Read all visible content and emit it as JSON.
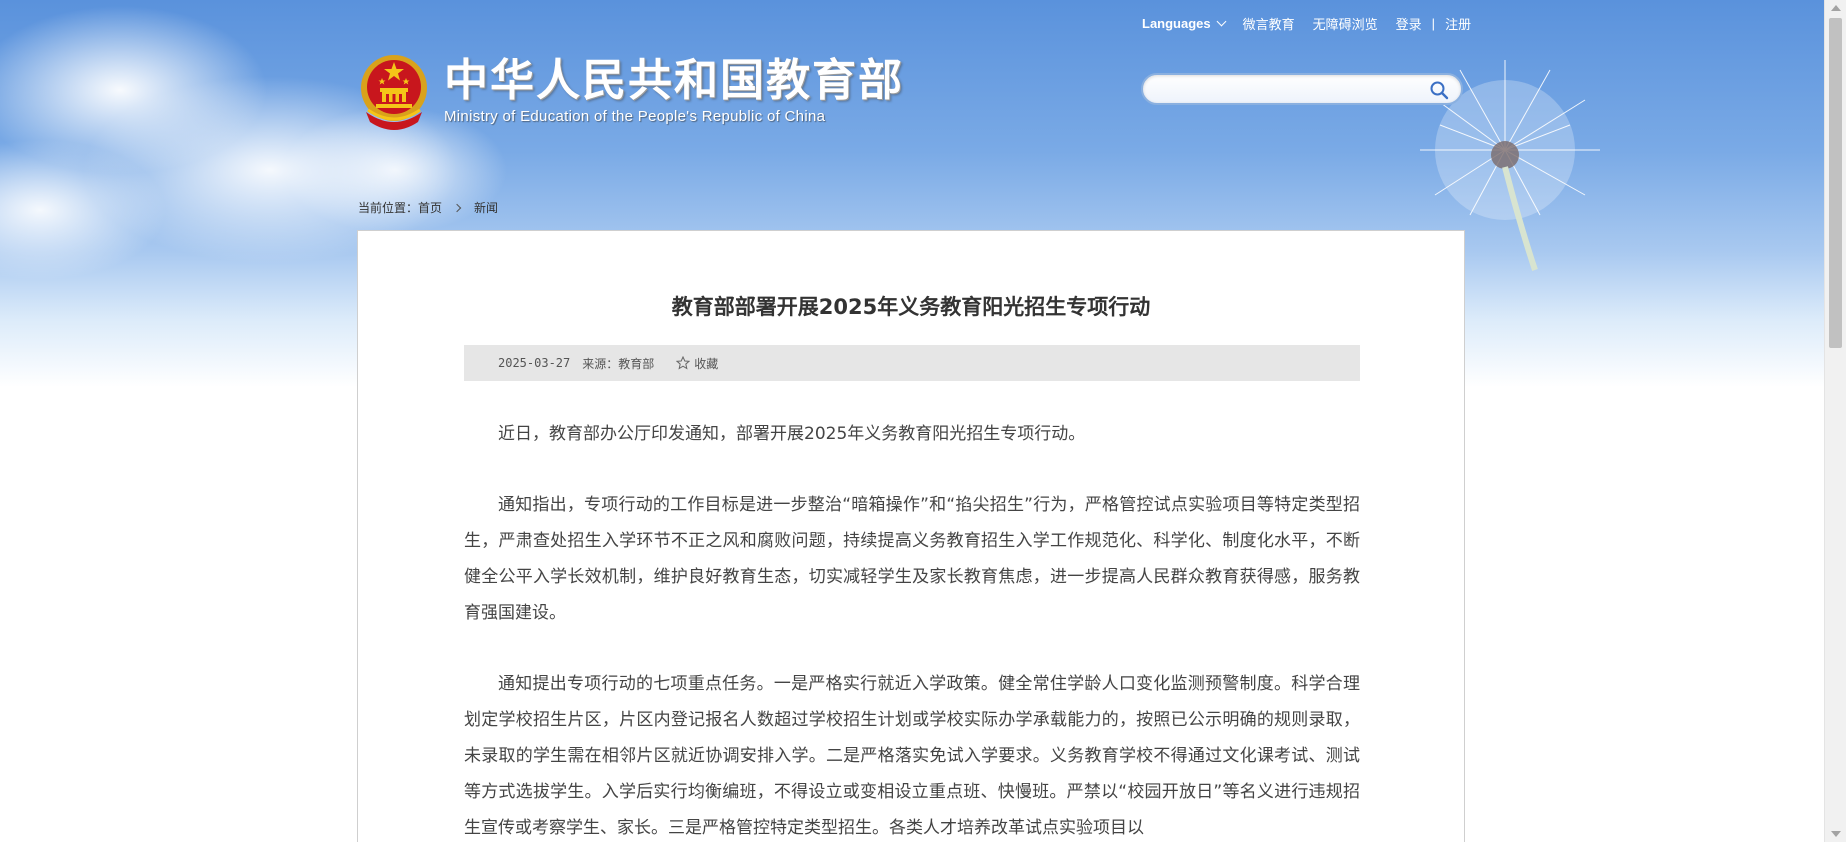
{
  "header": {
    "top_links": {
      "languages": "Languages",
      "weiyan": "微言教育",
      "accessible": "无障碍浏览",
      "login": "登录",
      "separator": "|",
      "register": "注册"
    },
    "logo": {
      "title_cn": "中华人民共和国教育部",
      "title_en": "Ministry of Education of the People's Republic of China"
    },
    "search": {
      "placeholder": "",
      "value": ""
    }
  },
  "breadcrumb": {
    "prefix": "当前位置：",
    "home": "首页",
    "current": "新闻"
  },
  "article": {
    "title": "教育部部署开展2025年义务教育阳光招生专项行动",
    "date": "2025-03-27",
    "source": "来源：教育部",
    "favorite": "收藏",
    "paragraphs": [
      "近日，教育部办公厅印发通知，部署开展2025年义务教育阳光招生专项行动。",
      "通知指出，专项行动的工作目标是进一步整治“暗箱操作”和“掐尖招生”行为，严格管控试点实验项目等特定类型招生，严肃查处招生入学环节不正之风和腐败问题，持续提高义务教育招生入学工作规范化、科学化、制度化水平，不断健全公平入学长效机制，维护良好教育生态，切实减轻学生及家长教育焦虑，进一步提高人民群众教育获得感，服务教育强国建设。",
      "通知提出专项行动的七项重点任务。一是严格实行就近入学政策。健全常住学龄人口变化监测预警制度。科学合理划定学校招生片区，片区内登记报名人数超过学校招生计划或学校实际办学承载能力的，按照已公示明确的规则录取，未录取的学生需在相邻片区就近协调安排入学。二是严格落实免试入学要求。义务教育学校不得通过文化课考试、测试等方式选拔学生。入学后实行均衡编班，不得设立或变相设立重点班、快慢班。严禁以“校园开放日”等名义进行违规招生宣传或考察学生、家长。三是严格管控特定类型招生。各类人才培养改革试点实验项目以"
    ]
  },
  "colors": {
    "sky_top": "#5a92dc",
    "meta_bar": "#e6e6e6",
    "text": "#444444"
  }
}
